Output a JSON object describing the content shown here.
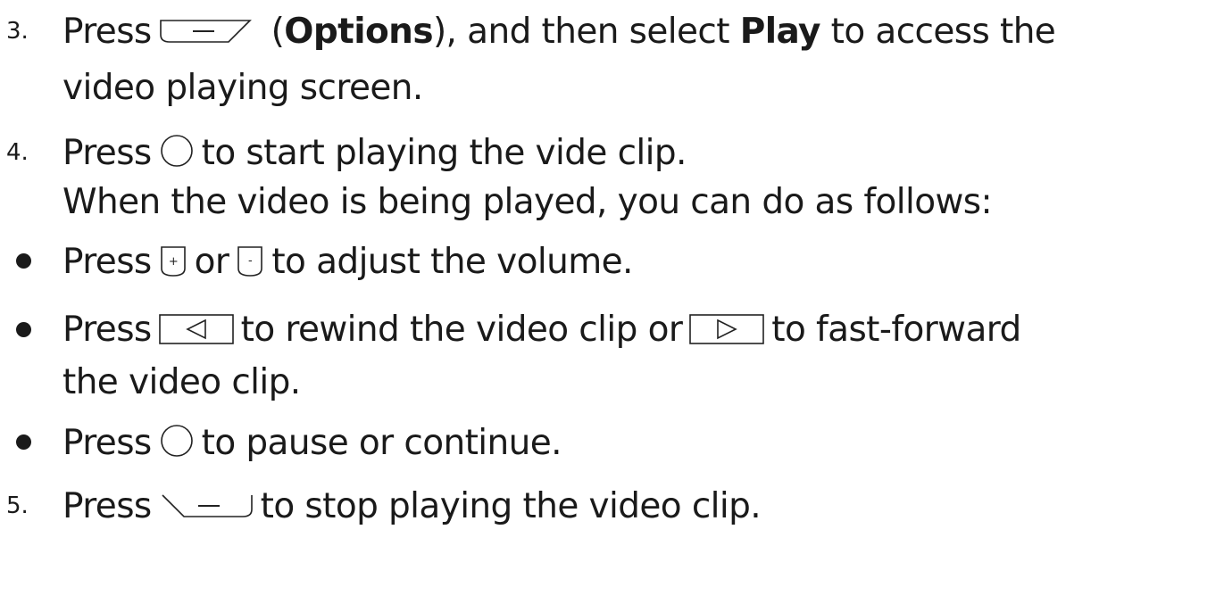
{
  "steps": {
    "s3": {
      "number": "3.",
      "l1_before": "Press",
      "l1_paren_open": "(",
      "l1_options": "Options",
      "l1_after_options": "), and then select",
      "l1_play": "Play",
      "l1_end": "to access the",
      "l2": "video playing screen.",
      "icon": "left-softkey-icon"
    },
    "s4": {
      "number": "4.",
      "l1_before": "Press",
      "l1_after": "to start playing the vide clip.",
      "l2": "When the video is being played, you can do as follows:",
      "icon": "ok-circle-key-icon"
    },
    "b1": {
      "before": "Press",
      "middle": "or",
      "after": "to adjust the volume.",
      "icons": [
        "volume-up-key-icon",
        "volume-down-key-icon"
      ]
    },
    "b2": {
      "before": "Press",
      "middle": "to rewind the video clip or",
      "after": "to fast-forward",
      "l2": "the video clip.",
      "icons": [
        "left-arrow-key-icon",
        "right-arrow-key-icon"
      ]
    },
    "b3": {
      "before": "Press",
      "after": "to pause or continue.",
      "icon": "ok-circle-key-icon"
    },
    "s5": {
      "number": "5.",
      "before": "Press",
      "after": "to stop playing the video clip.",
      "icon": "right-softkey-icon"
    }
  }
}
